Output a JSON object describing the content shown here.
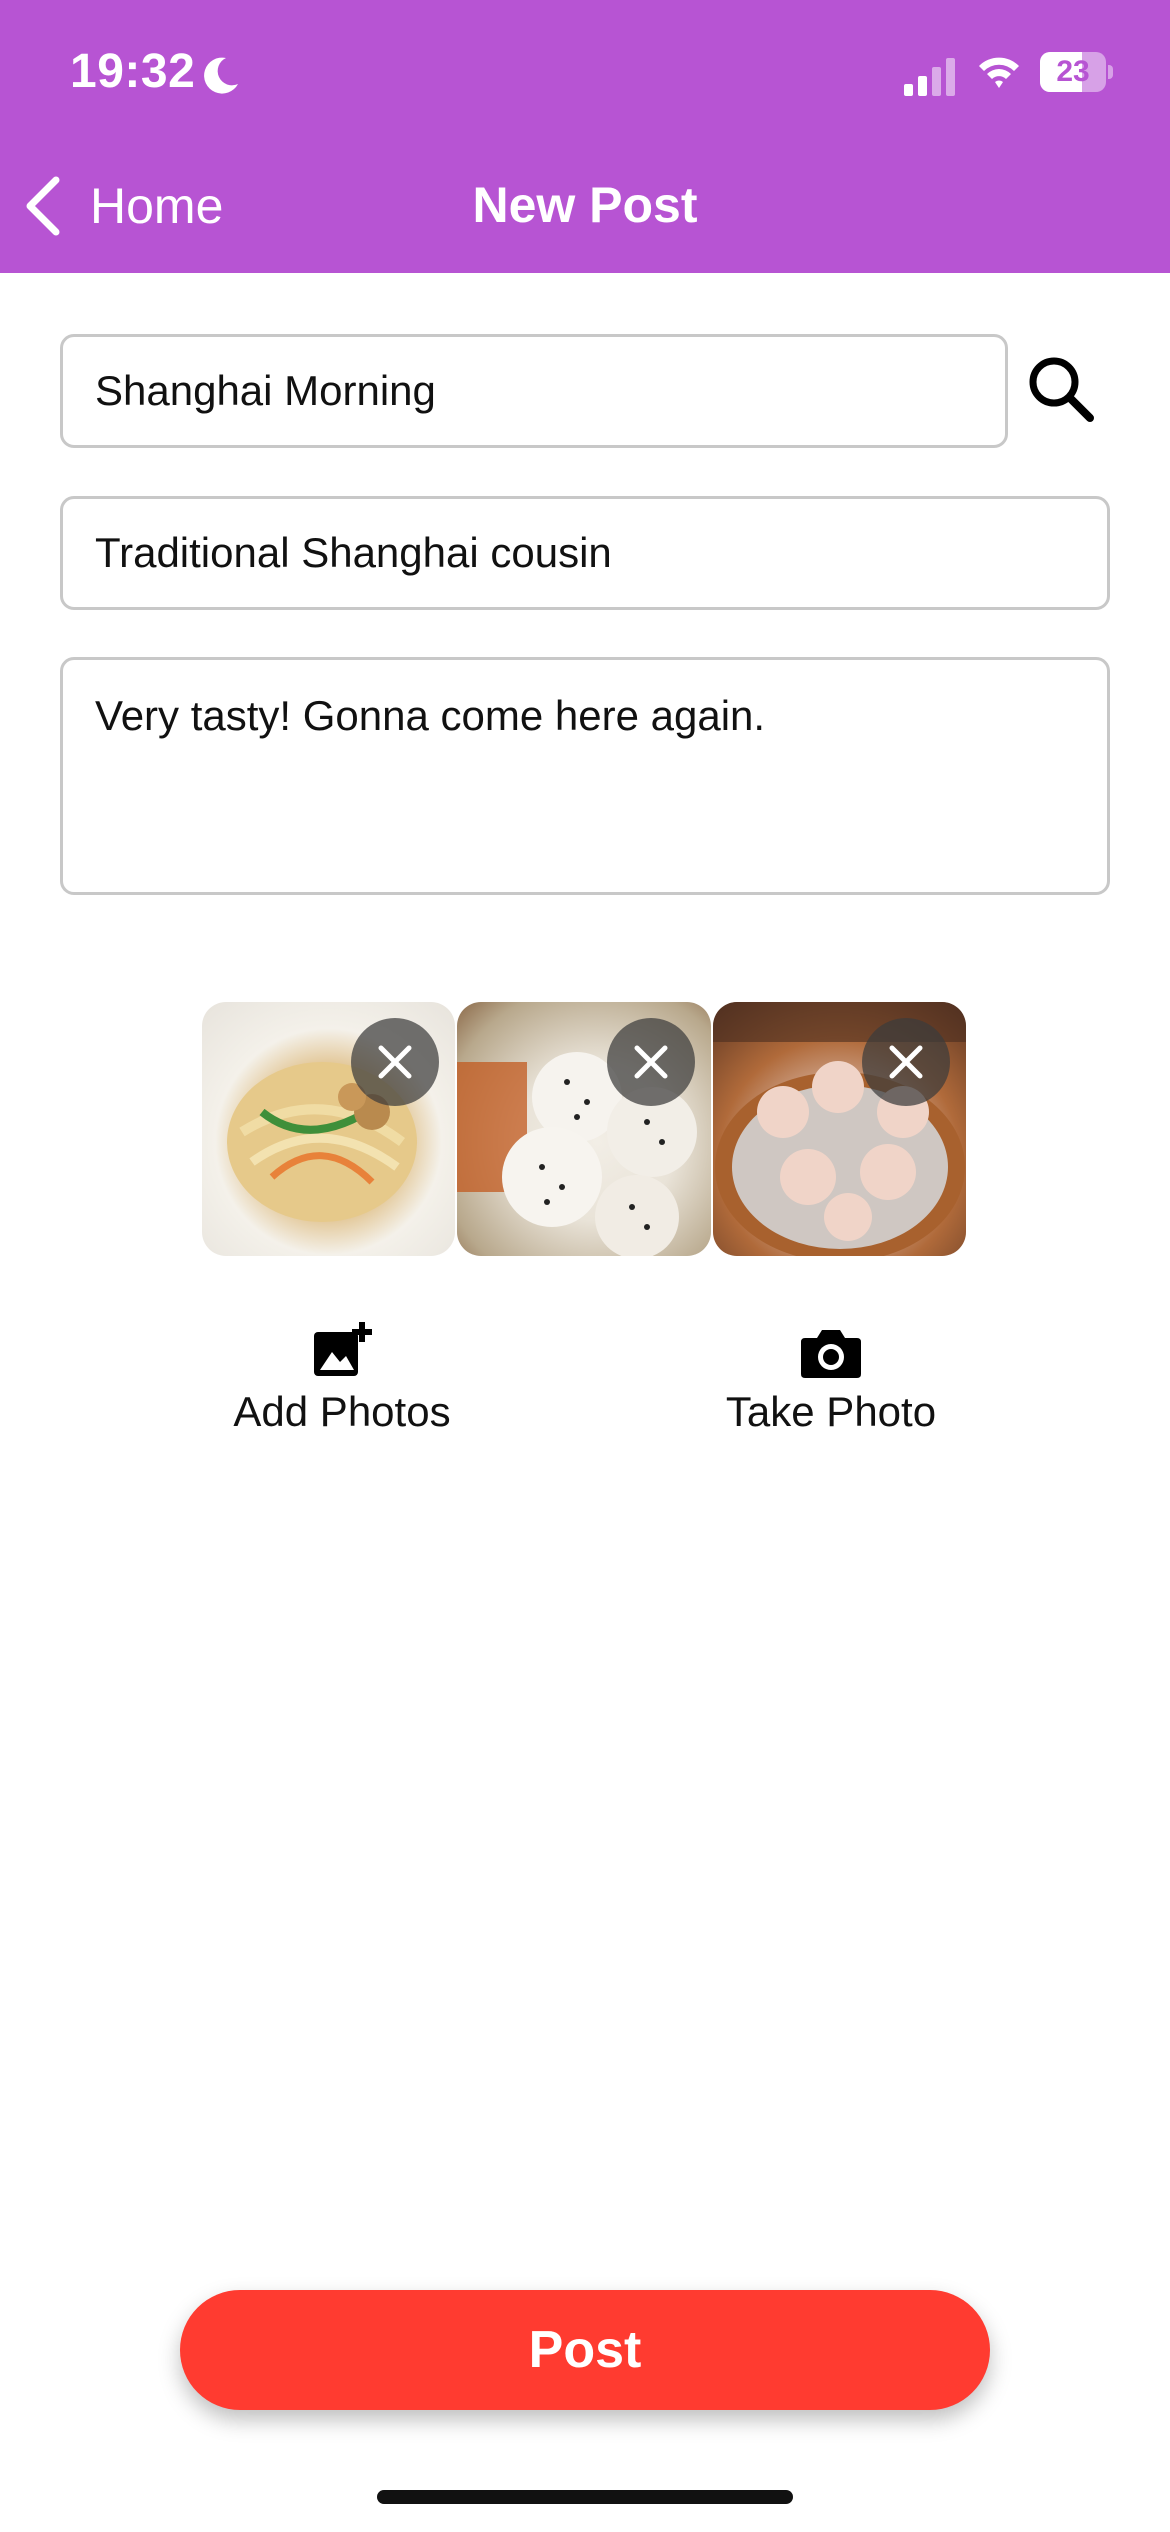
{
  "status_bar": {
    "time": "19:32",
    "battery": "23",
    "icons": [
      "moon-icon",
      "signal-icon",
      "wifi-icon",
      "battery-icon"
    ]
  },
  "nav": {
    "back_label": "Home",
    "title": "New Post",
    "back_icon": "chevron-left-icon"
  },
  "form": {
    "title_value": "Shanghai Morning",
    "subtitle_value": "Traditional Shanghai cousin",
    "body_value": "Very tasty! Gonna come here again.",
    "search_icon": "search-icon"
  },
  "photos": [
    {
      "name": "noodles-photo",
      "remove_icon": "close-icon"
    },
    {
      "name": "buns-photo",
      "remove_icon": "close-icon"
    },
    {
      "name": "dumplings-photo",
      "remove_icon": "close-icon"
    }
  ],
  "actions": {
    "add_photos_label": "Add Photos",
    "add_photos_icon": "add-photo-icon",
    "take_photo_label": "Take Photo",
    "take_photo_icon": "camera-icon"
  },
  "post_button": {
    "label": "Post"
  },
  "colors": {
    "header": "#b754d3",
    "post": "#ff3b30",
    "field_border": "#c8c8c8"
  }
}
